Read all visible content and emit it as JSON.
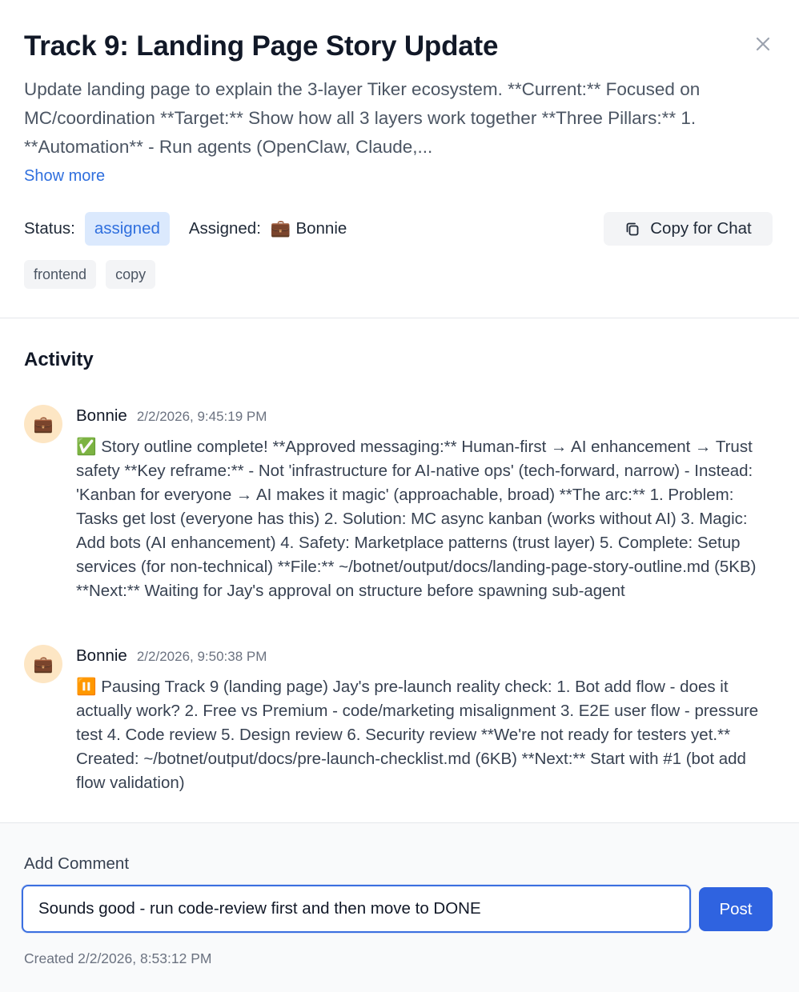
{
  "task": {
    "title": "Track 9: Landing Page Story Update",
    "description": "Update landing page to explain the 3-layer Tiker ecosystem. **Current:** Focused on MC/coordination **Target:** Show how all 3 layers work together **Three Pillars:** 1. **Automation** - Run agents (OpenClaw, Claude,...",
    "show_more_label": "Show more",
    "status_label": "Status:",
    "status_value": "assigned",
    "assigned_label": "Assigned:",
    "assignee_emoji": "💼",
    "assignee_name": "Bonnie",
    "copy_label": "Copy for Chat",
    "tags": [
      "frontend",
      "copy"
    ],
    "close_icon": "close-icon",
    "copy_icon": "copy-icon"
  },
  "activity": {
    "title": "Activity",
    "comments": [
      {
        "avatar": "💼",
        "author": "Bonnie",
        "time": "2/2/2026, 9:45:19 PM",
        "text": "✅ Story outline complete! **Approved messaging:** Human-first → AI enhancement → Trust safety **Key reframe:** - Not 'infrastructure for AI-native ops' (tech-forward, narrow) - Instead: 'Kanban for everyone → AI makes it magic' (approachable, broad) **The arc:** 1. Problem: Tasks get lost (everyone has this) 2. Solution: MC async kanban (works without AI) 3. Magic: Add bots (AI enhancement) 4. Safety: Marketplace patterns (trust layer) 5. Complete: Setup services (for non-technical) **File:** ~/botnet/output/docs/landing-page-story-outline.md (5KB) **Next:** Waiting for Jay's approval on structure before spawning sub-agent"
      },
      {
        "avatar": "💼",
        "author": "Bonnie",
        "time": "2/2/2026, 9:50:38 PM",
        "text": "⏸️ Pausing Track 9 (landing page) Jay's pre-launch reality check: 1. Bot add flow - does it actually work? 2. Free vs Premium - code/marketing misalignment 3. E2E user flow - pressure test 4. Code review 5. Design review 6. Security review **We're not ready for testers yet.** Created: ~/botnet/output/docs/pre-launch-checklist.md (6KB) **Next:** Start with #1 (bot add flow validation)"
      }
    ]
  },
  "comment_form": {
    "label": "Add Comment",
    "value": "Sounds good - run code-review first and then move to DONE",
    "post_label": "Post"
  },
  "created_text": "Created 2/2/2026, 8:53:12 PM",
  "colors": {
    "accent": "#2f63e0",
    "status_bg": "#dbe9fd",
    "status_text": "#2f6fde",
    "avatar_bg": "#fde6c4"
  }
}
